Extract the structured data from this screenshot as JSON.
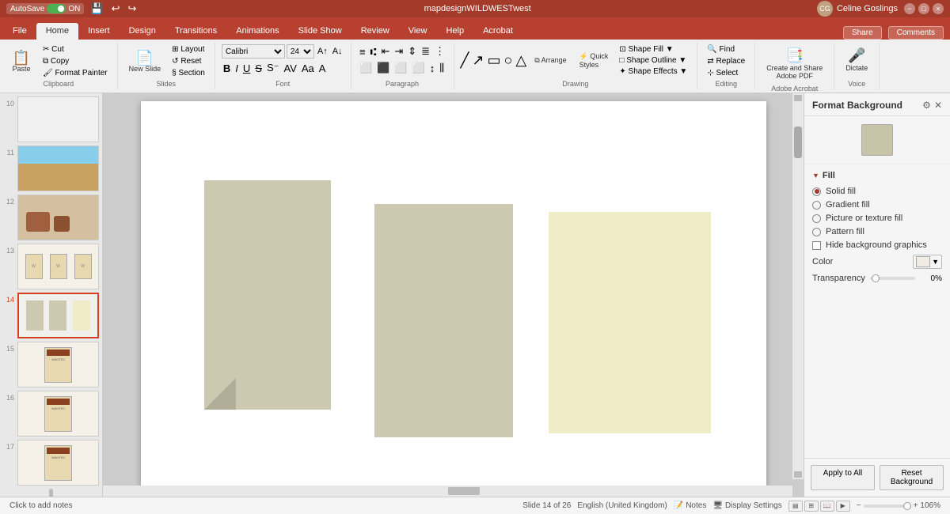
{
  "titleBar": {
    "autosave": "AutoSave",
    "autosave_on": "ON",
    "title": "mapdesignWILDWESTwest",
    "user": "Celine Goslings",
    "undo_icon": "↩",
    "redo_icon": "↪",
    "save_icon": "💾"
  },
  "ribbonTabs": {
    "tabs": [
      "File",
      "Home",
      "Insert",
      "Design",
      "Transitions",
      "Animations",
      "Slide Show",
      "Review",
      "View",
      "Help",
      "Acrobat"
    ],
    "active": "Home",
    "share_label": "Share",
    "comments_label": "Comments"
  },
  "ribbon": {
    "groups": [
      {
        "name": "Clipboard",
        "label": "Clipboard"
      },
      {
        "name": "Slides",
        "label": "Slides"
      },
      {
        "name": "Font",
        "label": "Font"
      },
      {
        "name": "Paragraph",
        "label": "Paragraph"
      },
      {
        "name": "Drawing",
        "label": "Drawing"
      },
      {
        "name": "Editing",
        "label": "Editing"
      },
      {
        "name": "AdobeAcrobat",
        "label": "Adobe Acrobat"
      },
      {
        "name": "Voice",
        "label": "Voice"
      }
    ],
    "paste_label": "Paste",
    "cut_label": "Cut",
    "copy_label": "Copy",
    "format_painter_label": "Format Painter",
    "new_slide_label": "New Slide",
    "layout_label": "Layout",
    "reset_label": "Reset",
    "section_label": "Section",
    "dictate_label": "Dictate",
    "find_label": "Find",
    "replace_label": "Replace",
    "select_label": "Select"
  },
  "slidePanel": {
    "slides": [
      {
        "num": "10",
        "type": "blank"
      },
      {
        "num": "11",
        "type": "landscape"
      },
      {
        "num": "12",
        "type": "rocks"
      },
      {
        "num": "13",
        "type": "wanted"
      },
      {
        "num": "14",
        "type": "rects",
        "active": true
      },
      {
        "num": "15",
        "type": "wanted-small"
      },
      {
        "num": "16",
        "type": "wanted-2"
      },
      {
        "num": "17",
        "type": "wanted-3"
      }
    ],
    "current": "Slide 14 of 26",
    "language": "English (United Kingdom)"
  },
  "canvas": {
    "notes_placeholder": "Click to add notes",
    "shapes": [
      {
        "id": "shape1",
        "color": "#ccc9b0",
        "folded": true
      },
      {
        "id": "shape2",
        "color": "#ccc9b0",
        "folded": false
      },
      {
        "id": "shape3",
        "color": "#f0ecc8",
        "folded": false
      }
    ]
  },
  "formatBackground": {
    "title": "Format Background",
    "fill_label": "Fill",
    "options": [
      {
        "id": "solid",
        "label": "Solid fill",
        "selected": true
      },
      {
        "id": "gradient",
        "label": "Gradient fill",
        "selected": false
      },
      {
        "id": "picture",
        "label": "Picture or texture fill",
        "selected": false
      },
      {
        "id": "pattern",
        "label": "Pattern fill",
        "selected": false
      }
    ],
    "hide_bg_label": "Hide background graphics",
    "color_label": "Color",
    "transparency_label": "Transparency",
    "transparency_value": "0%",
    "transparency_slider_val": 0,
    "apply_btn": "Apply to All",
    "reset_btn": "Reset Background"
  },
  "statusBar": {
    "notes_label": "Notes",
    "display_settings_label": "Display Settings",
    "zoom_label": "106%"
  }
}
